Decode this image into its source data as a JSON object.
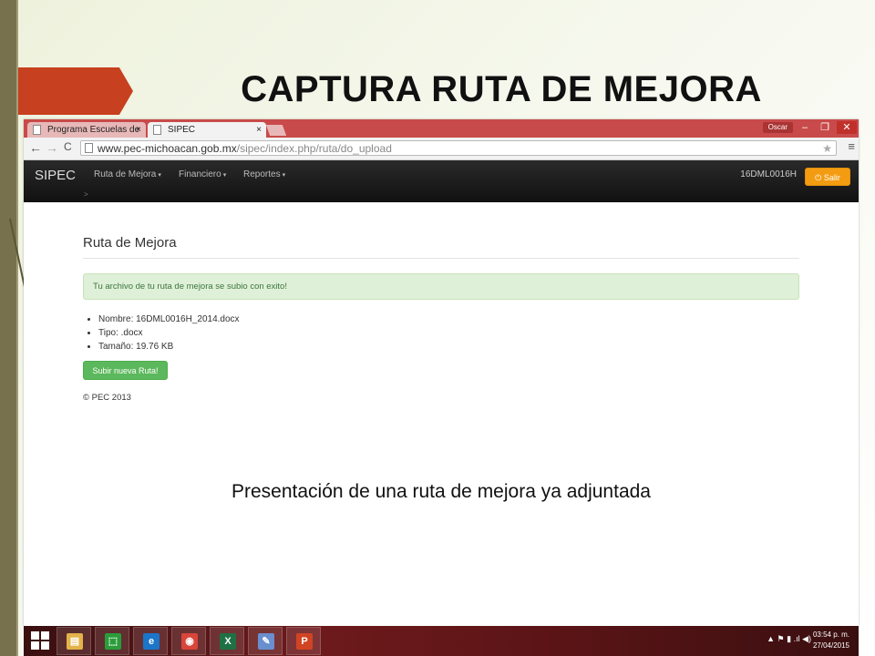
{
  "slide": {
    "title": "CAPTURA RUTA DE MEJORA",
    "caption": "Presentación de una ruta de mejora ya adjuntada"
  },
  "browser": {
    "tabs": [
      {
        "label": "Programa Escuelas de Cal",
        "close": "×"
      },
      {
        "label": "SIPEC",
        "close": "×"
      }
    ],
    "window_user": "Oscar",
    "window_controls": {
      "minimize": "–",
      "maximize": "❐",
      "close": "✕"
    },
    "nav_icons": {
      "back": "←",
      "forward": "→",
      "reload": "C"
    },
    "url_host": "www.pec-michoacan.gob.mx",
    "url_path": "/sipec/index.php/ruta/do_upload",
    "star_icon": "★",
    "menu_icon": "≡"
  },
  "site": {
    "brand": "SIPEC",
    "menu": [
      "Ruta de Mejora",
      "Financiero",
      "Reportes"
    ],
    "caret": "▾",
    "breadcrumb": ">",
    "school_code": "16DML0016H",
    "logout_label": "Salir",
    "logout_icon": "⏻",
    "page_heading": "Ruta de Mejora",
    "success_message": "Tu archivo de tu ruta de mejora se subio con exito!",
    "file_info": [
      "Nombre: 16DML0016H_2014.docx",
      "Tipo: .docx",
      "Tamaño: 19.76 KB"
    ],
    "upload_button": "Subir nueva Ruta!",
    "footer": "© PEC 2013"
  },
  "taskbar": {
    "apps": [
      {
        "icon": "file-explorer-icon",
        "glyph": "▤",
        "color": "#e3b34a"
      },
      {
        "icon": "store-icon",
        "glyph": "⬚",
        "color": "#2a9d3a"
      },
      {
        "icon": "internet-explorer-icon",
        "glyph": "e",
        "color": "#1b75c8"
      },
      {
        "icon": "chrome-icon",
        "glyph": "◉",
        "color": "#d9453a"
      },
      {
        "icon": "excel-icon",
        "glyph": "X",
        "color": "#1e7145"
      },
      {
        "icon": "paint-icon",
        "glyph": "✎",
        "color": "#6a8fd0"
      },
      {
        "icon": "powerpoint-icon",
        "glyph": "P",
        "color": "#d04423"
      }
    ],
    "tray_icons": "▲  ⚑  ▮  .ıl  ◀)",
    "time": "03:54 p. m.",
    "date": "27/04/2015"
  }
}
